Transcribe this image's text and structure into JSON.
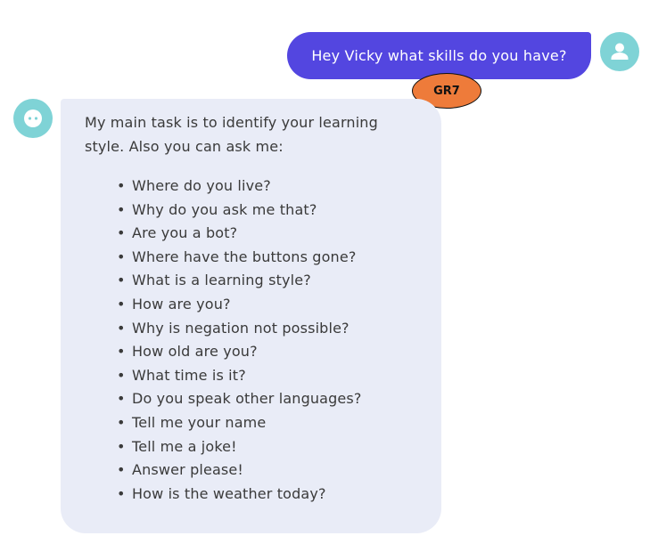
{
  "user_message": {
    "text": "Hey Vicky what skills do you have?",
    "avatar_icon": "user-icon"
  },
  "tag": {
    "label": "GR7",
    "color": "#ee7b3a"
  },
  "bot_message": {
    "avatar_icon": "bot-face-icon",
    "intro": "My main task is to identify your learning style. Also you can ask me:",
    "bullet": "•",
    "items": [
      "Where do you live?",
      "Why do you ask me that?",
      "Are you a bot?",
      "Where have the buttons gone?",
      "What is a learning style?",
      "How are you?",
      "Why is negation not possible?",
      "How old are you?",
      "What time is it?",
      "Do you speak other languages?",
      "Tell me your name",
      "Tell me a joke!",
      "Answer please!",
      "How is the weather today?"
    ]
  },
  "colors": {
    "user_bubble": "#5346e0",
    "bot_bubble": "#e9ecf7",
    "avatar": "#7fd3d6"
  }
}
